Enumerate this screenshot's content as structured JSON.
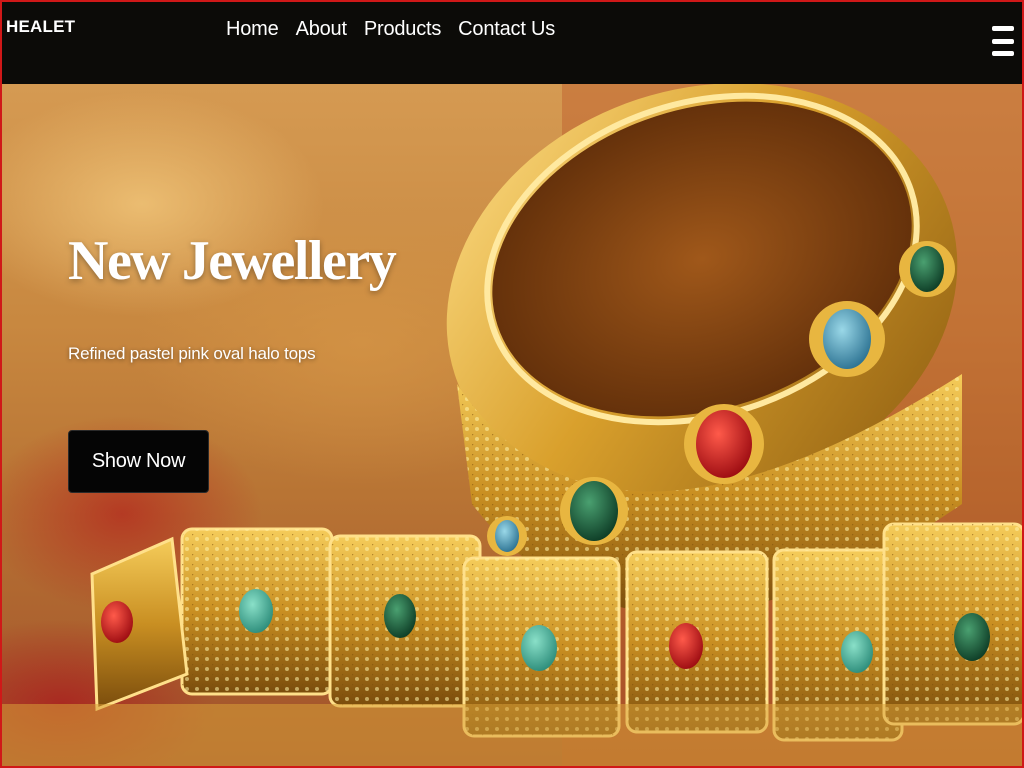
{
  "nav": {
    "brand": "HEALET",
    "links": [
      "Home",
      "About",
      "Products",
      "Contact Us"
    ],
    "menu_icon": "hamburger-menu-icon"
  },
  "hero": {
    "title": "New Jewellery",
    "subtitle": "Refined pastel pink oval halo tops",
    "button_label": "Show Now",
    "image": "gold-bangle-necklace-photo"
  },
  "colors": {
    "nav_bg": "#0c0b08",
    "button_bg": "#050505",
    "frame_border": "#d01818",
    "gold": "#d4a43a"
  }
}
